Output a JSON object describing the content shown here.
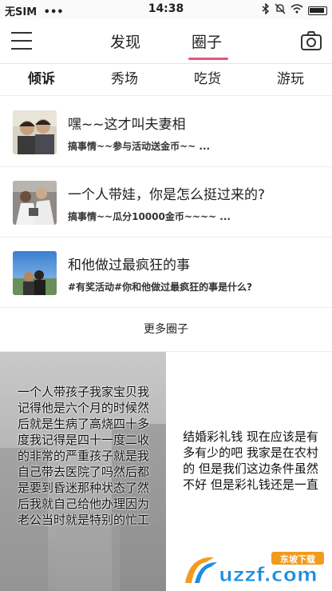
{
  "status_bar": {
    "carrier": "无SIM",
    "signal_dots": "•••",
    "time": "14:38"
  },
  "nav": {
    "tab_find": "发现",
    "tab_circle": "圈子"
  },
  "categories": [
    "倾诉",
    "秀场",
    "吃货",
    "游玩"
  ],
  "circles": [
    {
      "title": "嘿~~这才叫夫妻相",
      "subtitle": "搞事情~~参与活动送金币~~ ..."
    },
    {
      "title": "一个人带娃，你是怎么挺过来的?",
      "subtitle": "搞事情~~瓜分10000金币~~~~ ..."
    },
    {
      "title": "和他做过最疯狂的事",
      "subtitle": "#有奖活动#你和他做过最疯狂的事是什么?"
    }
  ],
  "more_circles": "更多圈子",
  "cards": [
    {
      "text": "一个人带孩子我家宝贝我记得他是六个月的时候然后就是生病了高烧四十多度我记得是四十一度二收的非常的严重孩子就是我自己带去医院了吗然后都是要到昏迷那种状态了然后我就自己给他办理因为老公当时就是特别的忙工"
    },
    {
      "text": "结婚彩礼钱 现在应该是有多有少的吧 我家是在农村的 但是我们这边条件虽然不好 但是彩礼钱还是一直"
    }
  ],
  "watermark": {
    "text": "uzzf.com",
    "tag": "东坡下载"
  },
  "colors": {
    "accent": "#e9547a",
    "watermark_blue": "#1a8fe0",
    "watermark_orange": "#f39a1e"
  }
}
